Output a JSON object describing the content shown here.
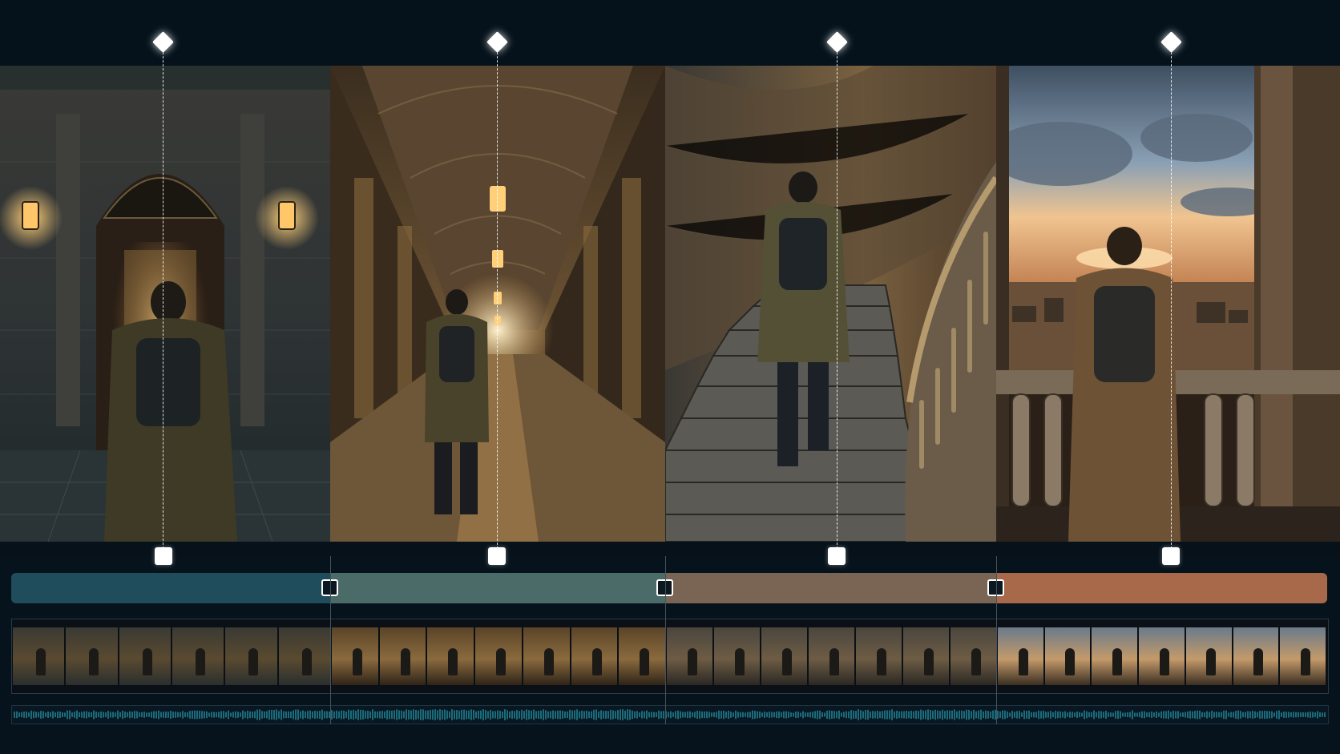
{
  "colors": {
    "background": "#06121b",
    "marker": "#ffffff",
    "waveform": "#1b6b7a"
  },
  "keyframes": [
    {
      "label": "",
      "icon": "diamond-keyframe-icon"
    },
    {
      "label": "",
      "icon": "diamond-keyframe-icon"
    },
    {
      "label": "",
      "icon": "diamond-keyframe-icon"
    },
    {
      "label": "",
      "icon": "diamond-keyframe-icon"
    }
  ],
  "scenes": [
    {
      "description_tag": "palace-doorway",
      "lamp_count": 2,
      "color": "#1f4d5c"
    },
    {
      "description_tag": "arched-corridor",
      "lamp_count": 4,
      "color": "#4a6b68"
    },
    {
      "description_tag": "spiral-staircase",
      "lamp_count": 0,
      "color": "#7a6554"
    },
    {
      "description_tag": "balcony-city-view",
      "lamp_count": 0,
      "color": "#a8684a"
    }
  ],
  "segments": [
    {
      "color": "#1f4d5c"
    },
    {
      "color": "#4a6b68"
    },
    {
      "color": "#7a6554"
    },
    {
      "color": "#a8684a"
    }
  ],
  "filmstrip": {
    "frames_per_scene": [
      6,
      7,
      7,
      7
    ]
  }
}
